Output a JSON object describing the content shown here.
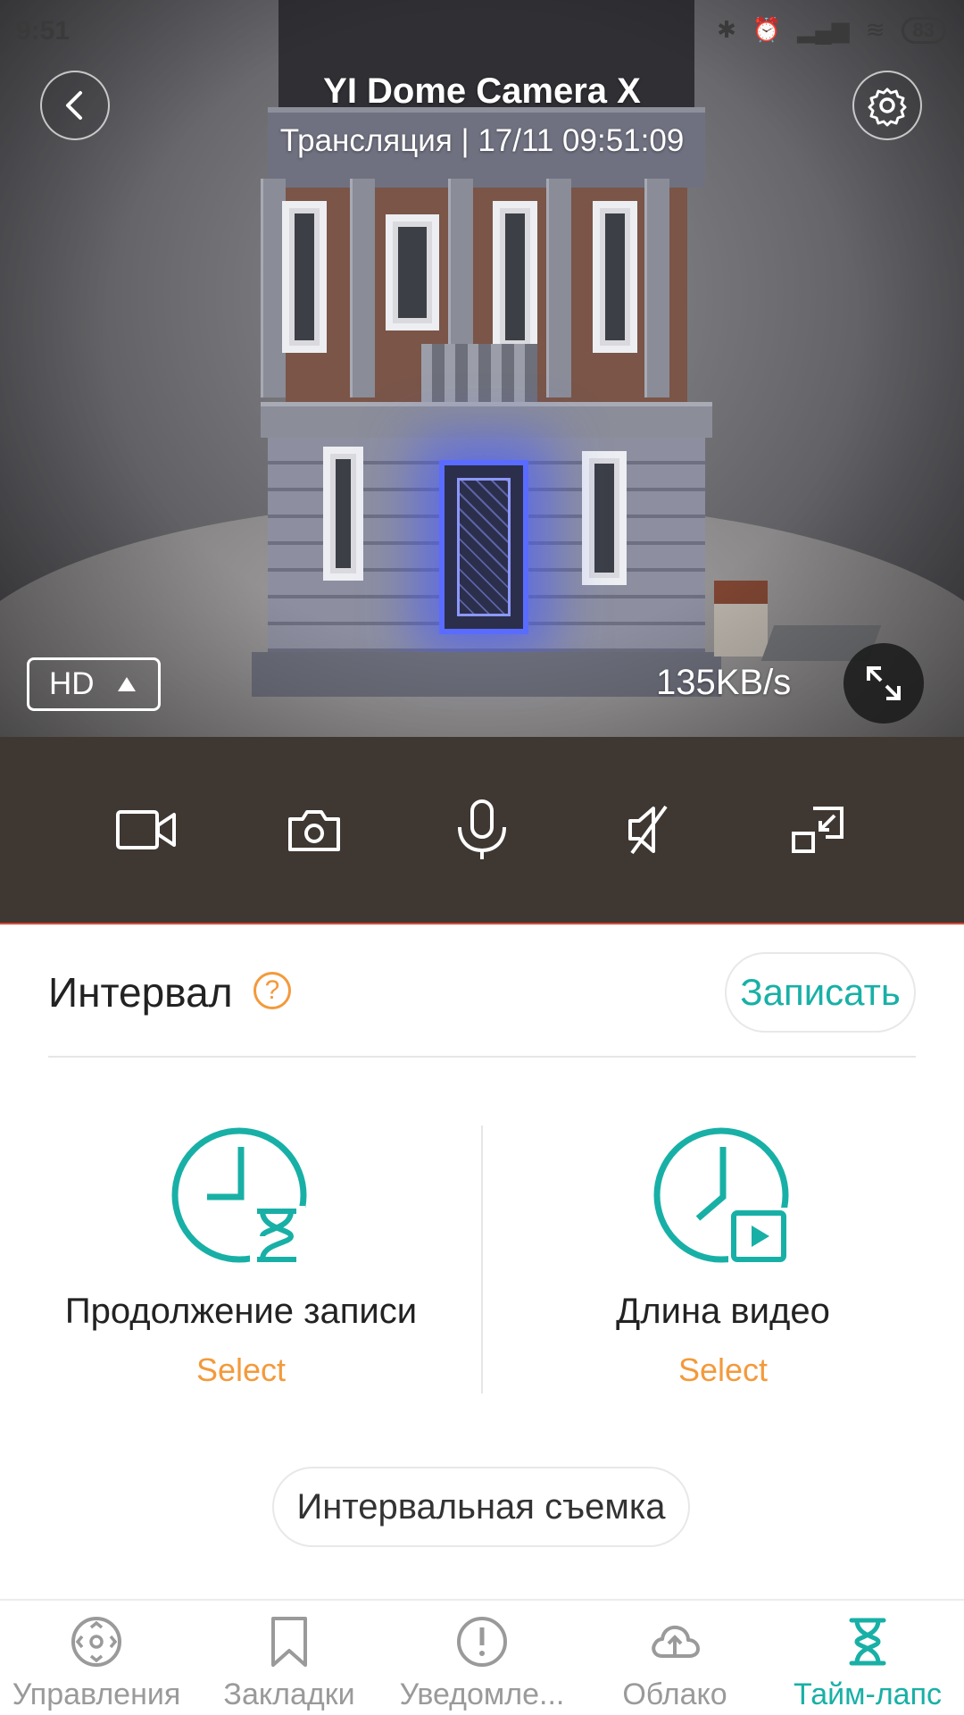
{
  "status_bar": {
    "time": "9:51",
    "battery": "83"
  },
  "camera": {
    "title": "YI Dome Camera X",
    "subtitle": "Трансляция | 17/11 09:51:09",
    "quality": "HD",
    "bitrate": "135KB/s"
  },
  "controls": [
    {
      "icon": "video-record-icon"
    },
    {
      "icon": "camera-snapshot-icon"
    },
    {
      "icon": "microphone-icon"
    },
    {
      "icon": "speaker-mute-icon"
    },
    {
      "icon": "exit-fullscreen-icon"
    }
  ],
  "timelapse": {
    "title": "Интервал",
    "help": "?",
    "record_label": "Записать",
    "options": [
      {
        "label": "Продолжение записи",
        "select": "Select",
        "icon": "clock-hourglass-icon"
      },
      {
        "label": "Длина видео",
        "select": "Select",
        "icon": "clock-video-icon"
      }
    ],
    "start_label": "Интервальная съемка"
  },
  "nav": {
    "items": [
      {
        "label": "Управления",
        "icon": "control-icon"
      },
      {
        "label": "Закладки",
        "icon": "bookmark-icon"
      },
      {
        "label": "Уведомле...",
        "icon": "alert-icon"
      },
      {
        "label": "Облако",
        "icon": "cloud-upload-icon"
      },
      {
        "label": "Тайм-лапс",
        "icon": "hourglass-icon",
        "active": true
      }
    ]
  },
  "colors": {
    "accent": "#18b0a6",
    "orange": "#f39a3c",
    "control_bar": "#3f3731"
  }
}
